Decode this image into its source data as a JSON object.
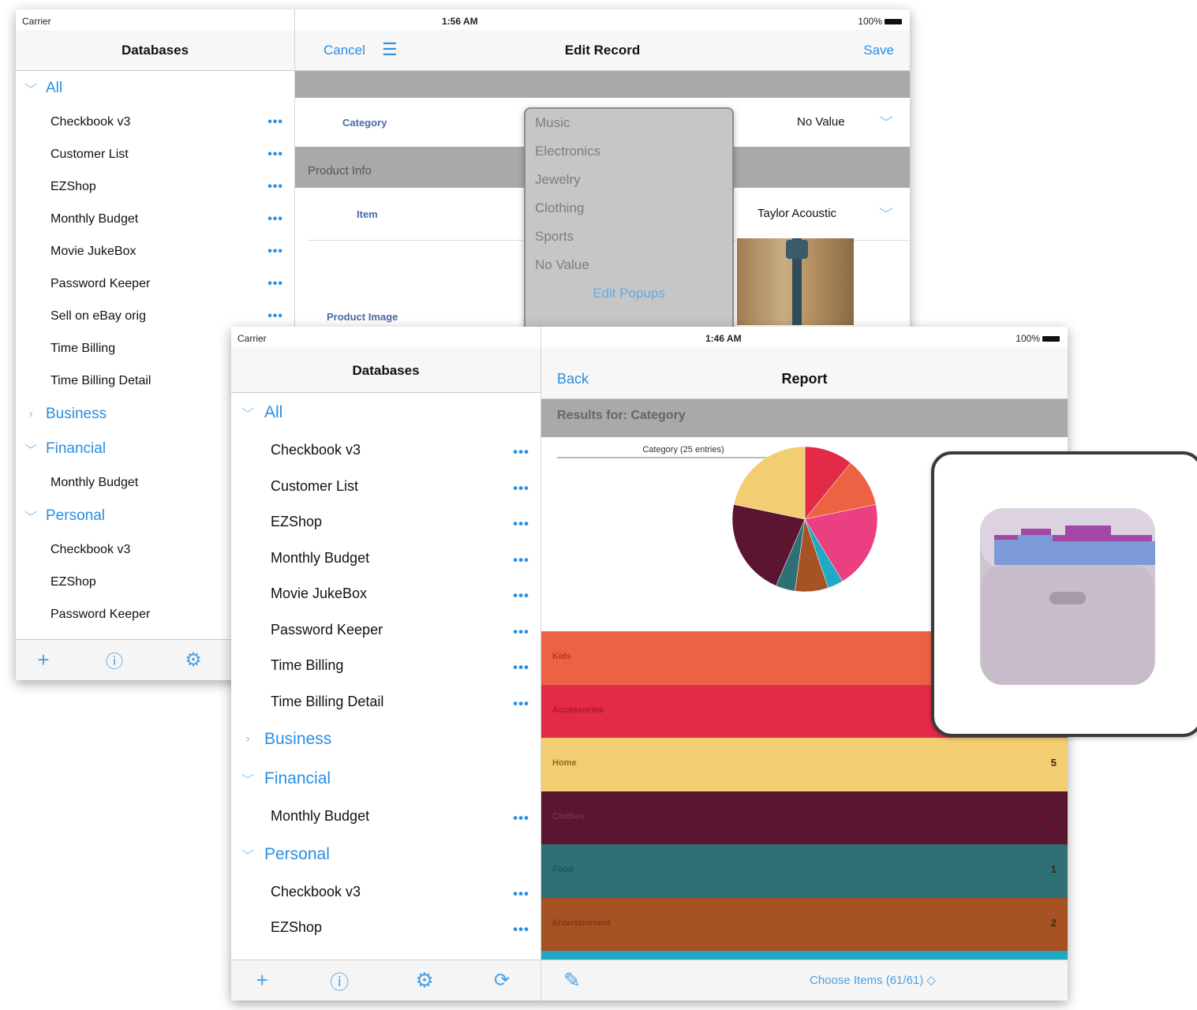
{
  "back_ipad": {
    "status": {
      "carrier": "Carrier",
      "time": "1:56 AM",
      "battery": "100%"
    },
    "sidebar": {
      "title": "Databases",
      "sections": [
        {
          "label": "All",
          "expanded": true,
          "items": [
            "Checkbook v3",
            "Customer List",
            "EZShop",
            "Monthly Budget",
            "Movie JukeBox",
            "Password Keeper",
            "Sell on eBay orig",
            "Time Billing",
            "Time Billing Detail"
          ]
        },
        {
          "label": "Business",
          "expanded": false,
          "items": []
        },
        {
          "label": "Financial",
          "expanded": true,
          "items": [
            "Monthly Budget"
          ]
        },
        {
          "label": "Personal",
          "expanded": true,
          "items": [
            "Checkbook v3",
            "EZShop",
            "Password Keeper"
          ]
        }
      ],
      "more_glyph": "•••"
    },
    "edit_record": {
      "cancel_label": "Cancel",
      "title": "Edit Record",
      "save_label": "Save",
      "category_label": "Category",
      "category_value": "No Value",
      "section_label": "Product Info",
      "item_label": "Item",
      "item_value": "Taylor Acoustic",
      "image_label": "Product Image",
      "popup_options": [
        "Music",
        "Electronics",
        "Jewelry",
        "Clothing",
        "Sports",
        "No Value"
      ],
      "popup_edit_label": "Edit Popups"
    }
  },
  "front_ipad": {
    "status": {
      "carrier": "Carrier",
      "time": "1:46 AM",
      "battery": "100%"
    },
    "sidebar": {
      "title": "Databases",
      "sections": [
        {
          "label": "All",
          "expanded": true,
          "items": [
            "Checkbook v3",
            "Customer List",
            "EZShop",
            "Monthly Budget",
            "Movie JukeBox",
            "Password Keeper",
            "Time Billing",
            "Time Billing Detail"
          ]
        },
        {
          "label": "Business",
          "expanded": false,
          "items": []
        },
        {
          "label": "Financial",
          "expanded": true,
          "items": [
            "Monthly Budget"
          ]
        },
        {
          "label": "Personal",
          "expanded": true,
          "items": [
            "Checkbook v3",
            "EZShop"
          ]
        }
      ],
      "more_glyph": "•••"
    },
    "report": {
      "back_label": "Back",
      "title": "Report",
      "results_label": "Results for: Category",
      "pie_caption": "Category (25 entries)",
      "choose_items_label": "Choose Items",
      "choose_items_count": "(61/61)",
      "bars": [
        {
          "label": "Kids",
          "count": "",
          "color": "#ee6244",
          "text_color": "#b03a22"
        },
        {
          "label": "Accessories",
          "count": "",
          "color": "#e42a49",
          "text_color": "#b01530"
        },
        {
          "label": "Home",
          "count": "5",
          "color": "#f3cd72",
          "text_color": "#8a6a1c"
        },
        {
          "label": "Clothes",
          "count": "5",
          "color": "#5b1530",
          "text_color": "#7a3050"
        },
        {
          "label": "Food",
          "count": "1",
          "color": "#2f7076",
          "text_color": "#1f5559"
        },
        {
          "label": "Entertainment",
          "count": "2",
          "color": "#a75224",
          "text_color": "#7e3a16"
        }
      ],
      "bottom_stripe_color": "#21a9c4"
    }
  },
  "chart_data": {
    "type": "pie",
    "title": "Category (25 entries)",
    "slices": [
      {
        "color": "#e42a49",
        "value": 2.5
      },
      {
        "color": "#ee6244",
        "value": 2.5
      },
      {
        "color": "#ea3f80",
        "value": 4.5
      },
      {
        "color": "#21a9c4",
        "value": 0.8
      },
      {
        "color": "#a75224",
        "value": 1.7
      },
      {
        "color": "#2f7076",
        "value": 1
      },
      {
        "color": "#5b1530",
        "value": 5
      },
      {
        "color": "#f3cd72",
        "value": 5
      }
    ]
  }
}
